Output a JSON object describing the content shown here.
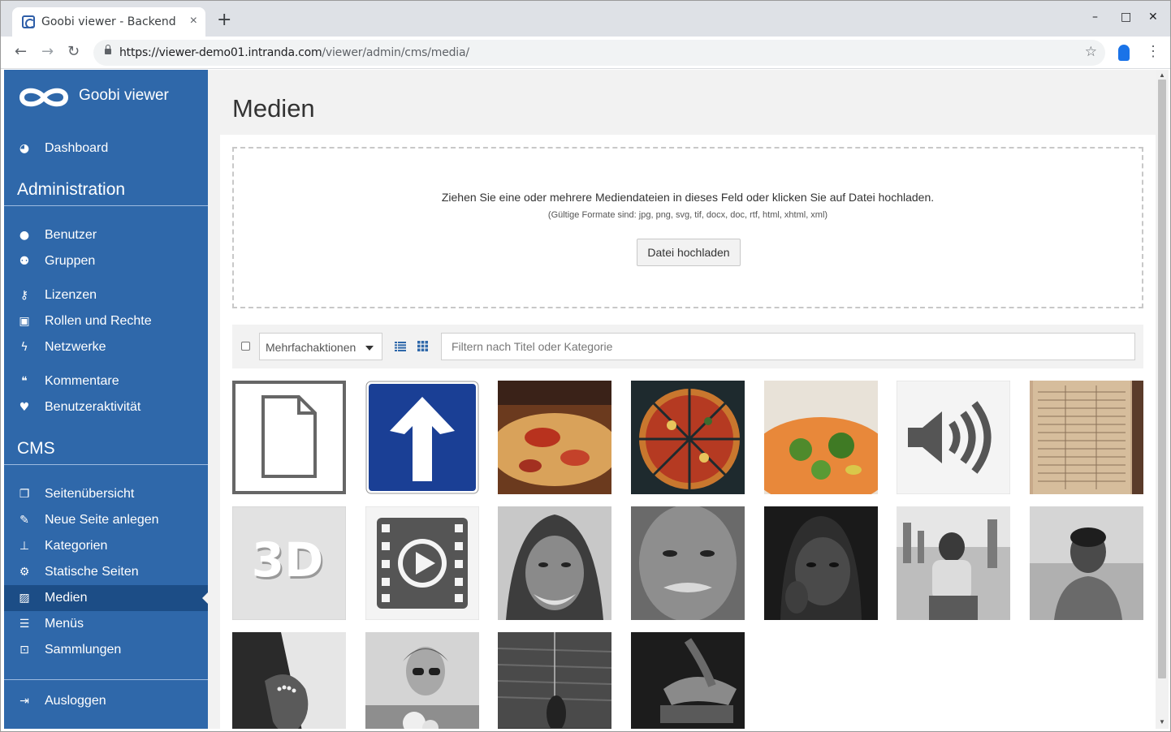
{
  "browser": {
    "tab_title": "Goobi viewer - Backend",
    "tab_close": "×",
    "new_tab": "+",
    "win_minimize": "–",
    "win_maximize": "□",
    "win_close": "✕",
    "url_host": "https://viewer-demo01.intranda.com",
    "url_path": "/viewer/admin/cms/media/"
  },
  "sidebar": {
    "brand": "Goobi viewer",
    "dashboard": {
      "label": "Dashboard",
      "icon": "dashboard-icon"
    },
    "admin_title": "Administration",
    "admin_items": [
      {
        "label": "Benutzer",
        "icon": "user-icon"
      },
      {
        "label": "Gruppen",
        "icon": "users-icon"
      },
      {
        "label": "Lizenzen",
        "icon": "key-icon"
      },
      {
        "label": "Rollen und Rechte",
        "icon": "lock-icon"
      },
      {
        "label": "Netzwerke",
        "icon": "bolt-icon"
      },
      {
        "label": "Kommentare",
        "icon": "comments-icon"
      },
      {
        "label": "Benutzeraktivität",
        "icon": "heartbeat-icon"
      }
    ],
    "cms_title": "CMS",
    "cms_items": [
      {
        "label": "Seitenübersicht",
        "icon": "files-icon"
      },
      {
        "label": "Neue Seite anlegen",
        "icon": "edit-icon"
      },
      {
        "label": "Kategorien",
        "icon": "thumbtack-icon"
      },
      {
        "label": "Statische Seiten",
        "icon": "cogs-icon"
      },
      {
        "label": "Medien",
        "icon": "image-icon",
        "active": true
      },
      {
        "label": "Menüs",
        "icon": "bars-icon"
      },
      {
        "label": "Sammlungen",
        "icon": "collection-icon"
      }
    ],
    "logout": {
      "label": "Ausloggen",
      "icon": "sign-out-icon"
    }
  },
  "main": {
    "title": "Medien",
    "dropzone": {
      "text": "Ziehen Sie eine oder mehrere Mediendateien in dieses Feld oder klicken Sie auf Datei hochladen.",
      "formats": "(Gültige Formate sind: jpg, png, svg, tif, docx, doc, rtf, html, xhtml, xml)",
      "button": "Datei hochladen"
    },
    "filter": {
      "bulk_actions": "Mehrfachaktionen",
      "search_placeholder": "Filtern nach Titel oder Kategorie"
    },
    "thumbnails": [
      "document-placeholder",
      "arrow-up-sign",
      "pizza-slice-photo",
      "pizza-top-view-photo",
      "pizza-vegetable-photo",
      "audio-placeholder",
      "newspaper-scan",
      "3d-placeholder",
      "video-placeholder",
      "old-man-hood-portrait",
      "old-man-portrait",
      "man-hoodie-portrait",
      "boy-street-photo",
      "boy-portrait",
      "holding-hands-photo",
      "woman-sunglasses-photo",
      "person-on-pier-photo",
      "hands-book-photo"
    ]
  },
  "colors": {
    "sidebar": "#2f68aa",
    "sidebar_active": "#1c4d86",
    "page_bg": "#f2f2f2"
  }
}
